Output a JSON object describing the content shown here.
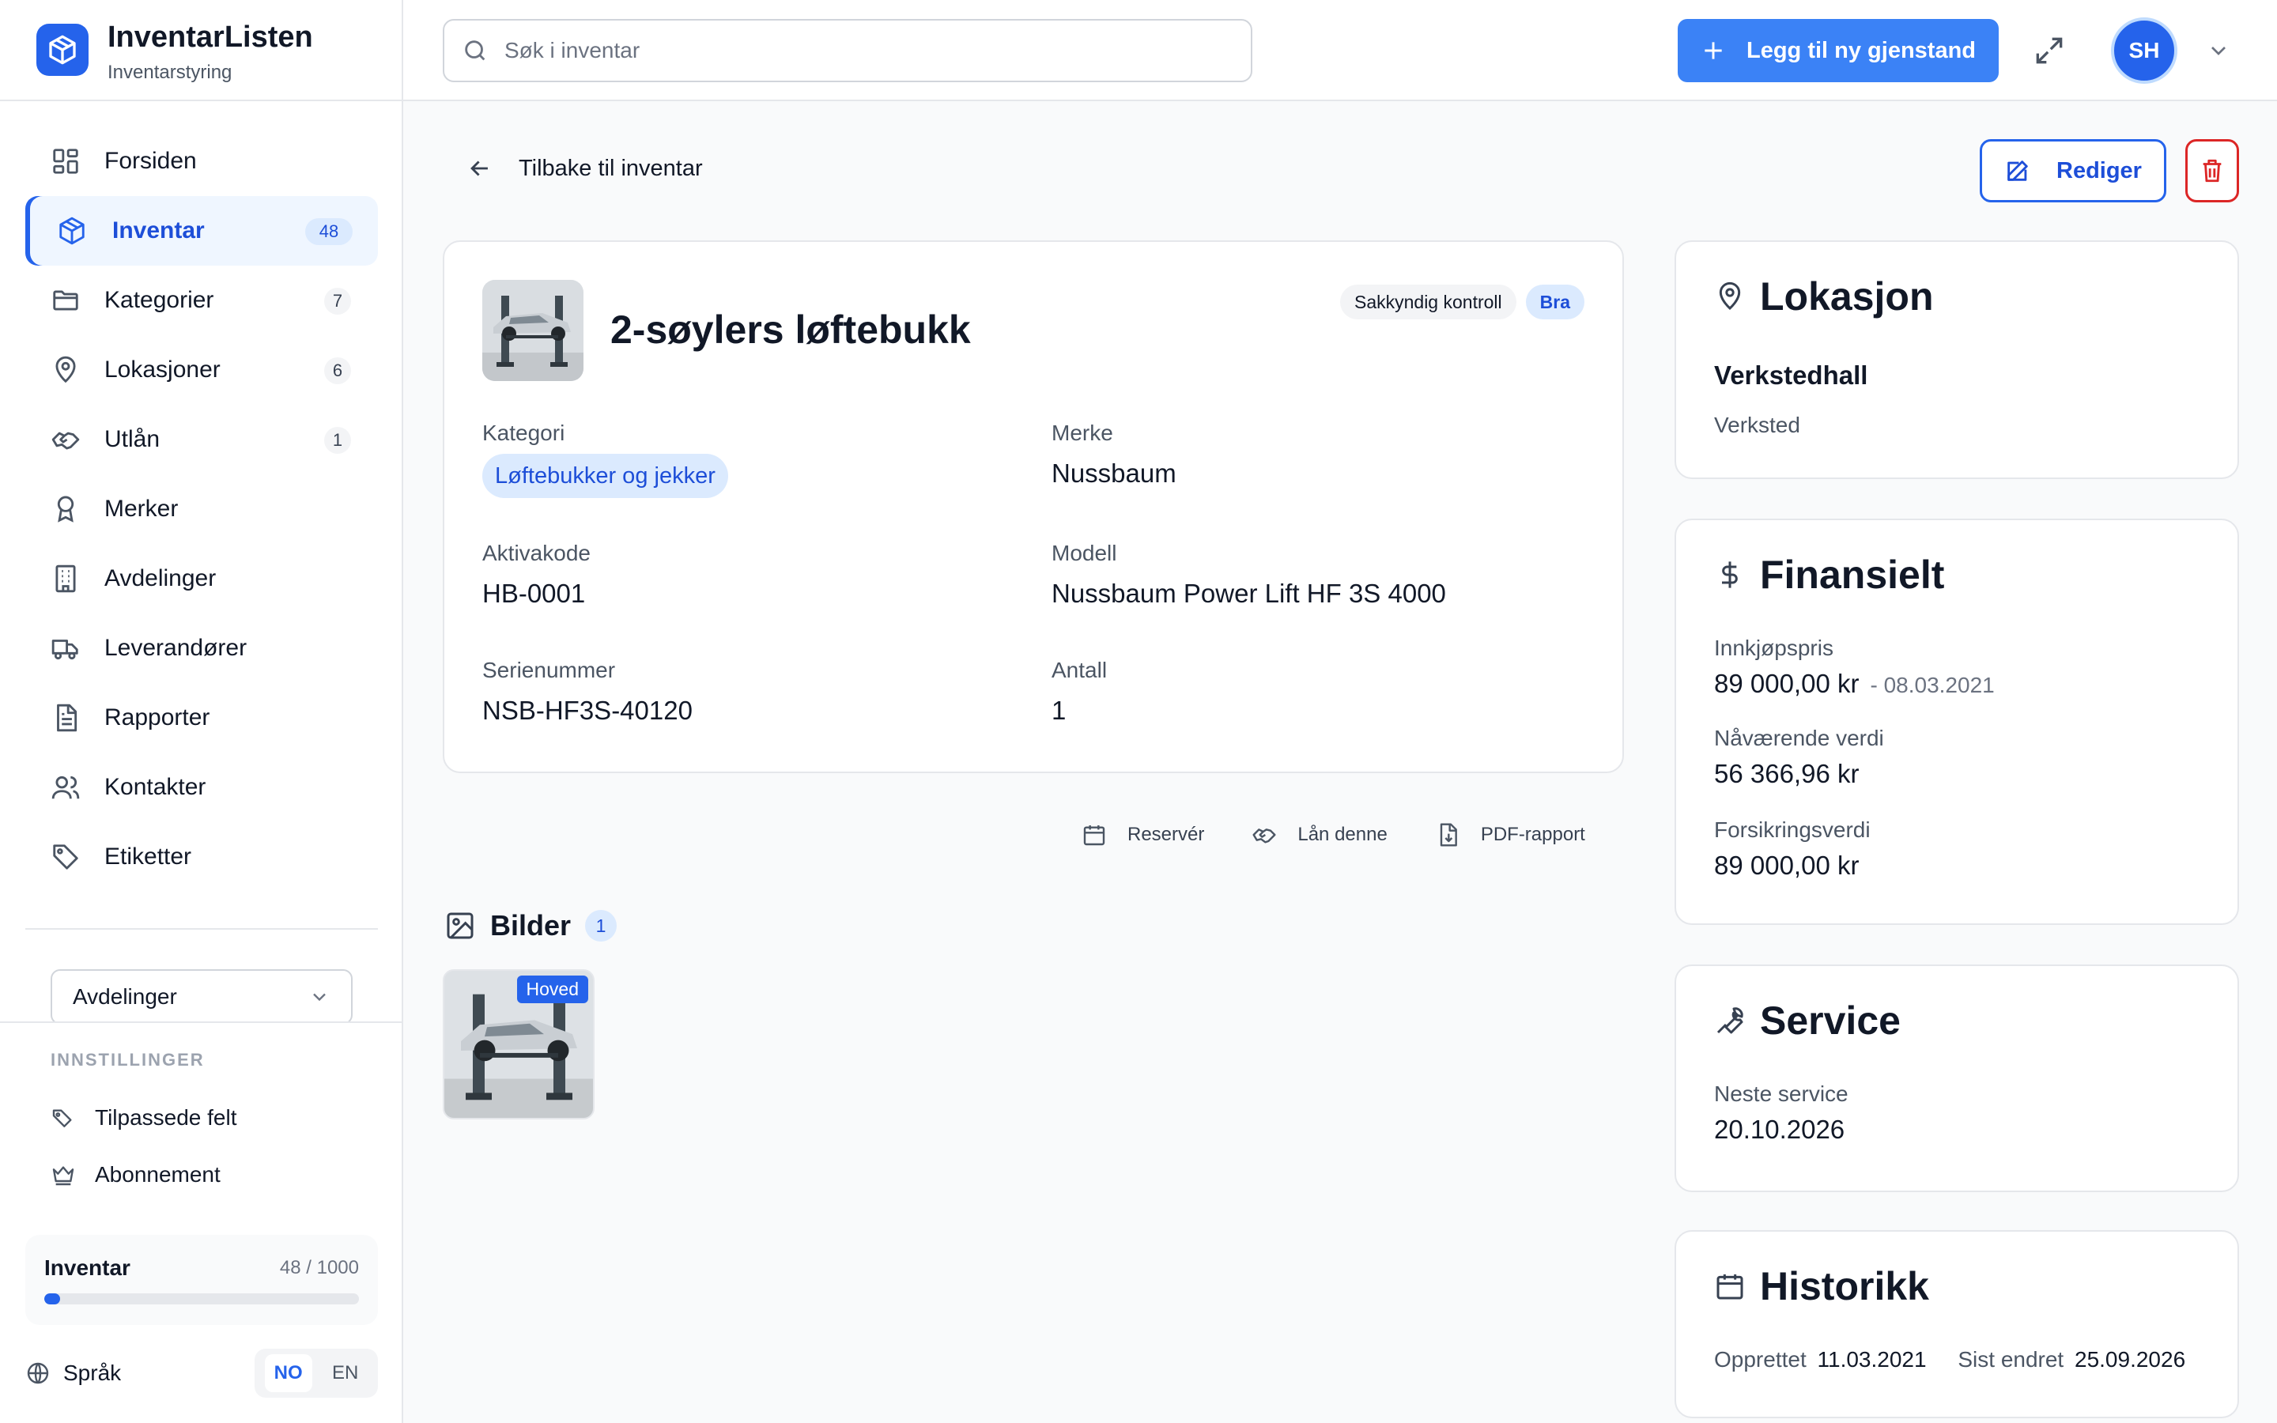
{
  "brand": {
    "name": "InventarListen",
    "subtitle": "Inventarstyring"
  },
  "nav": [
    {
      "label": "Forsiden",
      "count": "",
      "icon": "grid-icon"
    },
    {
      "label": "Inventar",
      "count": "48",
      "icon": "box-icon"
    },
    {
      "label": "Kategorier",
      "count": "7",
      "icon": "folder-icon"
    },
    {
      "label": "Lokasjoner",
      "count": "6",
      "icon": "map-pin-icon"
    },
    {
      "label": "Utlån",
      "count": "1",
      "icon": "handshake-icon"
    },
    {
      "label": "Merker",
      "count": "",
      "icon": "award-icon"
    },
    {
      "label": "Avdelinger",
      "count": "",
      "icon": "building-icon"
    },
    {
      "label": "Leverandører",
      "count": "",
      "icon": "truck-icon"
    },
    {
      "label": "Rapporter",
      "count": "",
      "icon": "file-text-icon"
    },
    {
      "label": "Kontakter",
      "count": "",
      "icon": "users-icon"
    },
    {
      "label": "Etiketter",
      "count": "",
      "icon": "tag-icon"
    }
  ],
  "department_select": {
    "value": "Avdelinger"
  },
  "settings": {
    "title": "INNSTILLINGER",
    "items": [
      {
        "label": "Tilpassede felt",
        "icon": "tags-icon"
      },
      {
        "label": "Abonnement",
        "icon": "crown-icon"
      }
    ]
  },
  "usage": {
    "label": "Inventar",
    "value": "48 / 1000",
    "fraction": 0.048
  },
  "language": {
    "label": "Språk",
    "options": [
      "NO",
      "EN"
    ],
    "selected": "NO"
  },
  "topbar": {
    "search_placeholder": "Søk i inventar",
    "add_label": "Legg til ny gjenstand",
    "user_initials": "SH"
  },
  "page": {
    "back_label": "Tilbake til inventar",
    "edit_label": "Rediger"
  },
  "item": {
    "title": "2-søylers løftebukk",
    "badges": [
      "Sakkyndig kontroll",
      "Bra"
    ],
    "fields": {
      "category_label": "Kategori",
      "category_value": "Løftebukker og jekker",
      "brand_label": "Merke",
      "brand_value": "Nussbaum",
      "asset_label": "Aktivakode",
      "asset_value": "HB-0001",
      "model_label": "Modell",
      "model_value": "Nussbaum Power Lift HF 3S 4000",
      "serial_label": "Serienummer",
      "serial_value": "NSB-HF3S-40120",
      "qty_label": "Antall",
      "qty_value": "1"
    },
    "actions": [
      "Reservér",
      "Lån denne",
      "PDF-rapport"
    ]
  },
  "images": {
    "title": "Bilder",
    "count": "1",
    "main_label": "Hoved"
  },
  "location": {
    "title": "Lokasjon",
    "name": "Verkstedhall",
    "type": "Verksted"
  },
  "finance": {
    "title": "Finansielt",
    "purchase_label": "Innkjøpspris",
    "purchase_value": "89 000,00 kr",
    "purchase_date": "- 08.03.2021",
    "current_label": "Nåværende verdi",
    "current_value": "56 366,96 kr",
    "insurance_label": "Forsikringsverdi",
    "insurance_value": "89 000,00 kr"
  },
  "service": {
    "title": "Service",
    "next_label": "Neste service",
    "next_value": "20.10.2026"
  },
  "history": {
    "title": "Historikk",
    "created_label": "Opprettet",
    "created_value": "11.03.2021",
    "changed_label": "Sist endret",
    "changed_value": "25.09.2026"
  },
  "colors": {
    "accent": "#2563eb",
    "danger": "#dc2626",
    "accent_light": "#dbeafe"
  }
}
